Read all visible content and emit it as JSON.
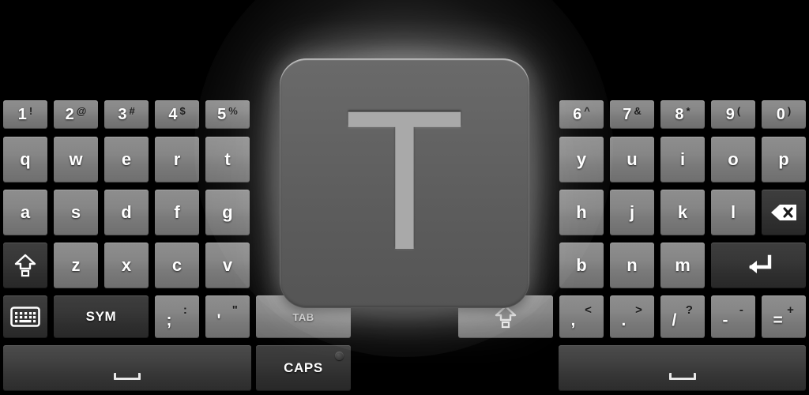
{
  "keyboard": {
    "title": "Android Hardware-Style Soft Keyboard",
    "theme": {
      "background": "#000000",
      "key_light": "#868686",
      "key_dark": "#373737",
      "key_space": "#434343",
      "text": "#ffffff",
      "alt_text": "#1c1c1c",
      "preview_face": "#636363",
      "preview_glyph": "#a9a9a9",
      "glow": "#ffffff"
    },
    "preview": {
      "character": "T",
      "source_key": "t"
    },
    "rows": [
      {
        "name": "number-row",
        "keys": [
          {
            "name": "key-1",
            "main": "1",
            "alt": "!",
            "type": "number"
          },
          {
            "name": "key-2",
            "main": "2",
            "alt": "@",
            "type": "number"
          },
          {
            "name": "key-3",
            "main": "3",
            "alt": "#",
            "type": "number"
          },
          {
            "name": "key-4",
            "main": "4",
            "alt": "$",
            "type": "number"
          },
          {
            "name": "key-5",
            "main": "5",
            "alt": "%",
            "type": "number"
          },
          {
            "name": "key-6",
            "main": "6",
            "alt": "^",
            "type": "number"
          },
          {
            "name": "key-7",
            "main": "7",
            "alt": "&",
            "type": "number"
          },
          {
            "name": "key-8",
            "main": "8",
            "alt": "*",
            "type": "number"
          },
          {
            "name": "key-9",
            "main": "9",
            "alt": "(",
            "type": "number"
          },
          {
            "name": "key-0",
            "main": "0",
            "alt": ")",
            "type": "number"
          }
        ]
      },
      {
        "name": "letter-row-1",
        "keys": [
          {
            "name": "key-q",
            "main": "q",
            "type": "letter"
          },
          {
            "name": "key-w",
            "main": "w",
            "type": "letter"
          },
          {
            "name": "key-e",
            "main": "e",
            "type": "letter"
          },
          {
            "name": "key-r",
            "main": "r",
            "type": "letter"
          },
          {
            "name": "key-t",
            "main": "t",
            "type": "letter"
          },
          {
            "name": "key-y",
            "main": "y",
            "type": "letter"
          },
          {
            "name": "key-u",
            "main": "u",
            "type": "letter"
          },
          {
            "name": "key-i",
            "main": "i",
            "type": "letter"
          },
          {
            "name": "key-o",
            "main": "o",
            "type": "letter"
          },
          {
            "name": "key-p",
            "main": "p",
            "type": "letter"
          }
        ]
      },
      {
        "name": "letter-row-2",
        "keys": [
          {
            "name": "key-a",
            "main": "a",
            "type": "letter"
          },
          {
            "name": "key-s",
            "main": "s",
            "type": "letter"
          },
          {
            "name": "key-d",
            "main": "d",
            "type": "letter"
          },
          {
            "name": "key-f",
            "main": "f",
            "type": "letter"
          },
          {
            "name": "key-g",
            "main": "g",
            "type": "letter"
          },
          {
            "name": "key-h",
            "main": "h",
            "type": "letter"
          },
          {
            "name": "key-j",
            "main": "j",
            "type": "letter"
          },
          {
            "name": "key-k",
            "main": "k",
            "type": "letter"
          },
          {
            "name": "key-l",
            "main": "l",
            "type": "letter"
          },
          {
            "name": "key-backspace",
            "main": "",
            "icon": "backspace-icon",
            "type": "function"
          }
        ]
      },
      {
        "name": "letter-row-3",
        "keys": [
          {
            "name": "key-shift-left",
            "main": "",
            "icon": "shift-icon",
            "type": "function"
          },
          {
            "name": "key-z",
            "main": "z",
            "type": "letter"
          },
          {
            "name": "key-x",
            "main": "x",
            "type": "letter"
          },
          {
            "name": "key-c",
            "main": "c",
            "type": "letter"
          },
          {
            "name": "key-v",
            "main": "v",
            "type": "letter"
          },
          {
            "name": "key-b",
            "main": "b",
            "type": "letter"
          },
          {
            "name": "key-n",
            "main": "n",
            "type": "letter"
          },
          {
            "name": "key-m",
            "main": "m",
            "type": "letter"
          },
          {
            "name": "key-enter",
            "main": "",
            "icon": "enter-icon",
            "type": "function"
          }
        ]
      },
      {
        "name": "symbol-row",
        "keys": [
          {
            "name": "key-keyboard-toggle",
            "main": "",
            "icon": "keyboard-icon",
            "type": "function"
          },
          {
            "name": "key-sym",
            "main": "SYM",
            "type": "function"
          },
          {
            "name": "key-semicolon",
            "main": ";",
            "alt": ":",
            "type": "punct"
          },
          {
            "name": "key-apostrophe",
            "main": "'",
            "alt": "\"",
            "type": "punct"
          },
          {
            "name": "key-tab",
            "main": "TAB",
            "type": "function"
          },
          {
            "name": "key-shift-right",
            "main": "",
            "icon": "shift-icon",
            "type": "function"
          },
          {
            "name": "key-comma",
            "main": ",",
            "alt": "<",
            "type": "punct"
          },
          {
            "name": "key-period",
            "main": ".",
            "alt": ">",
            "type": "punct"
          },
          {
            "name": "key-slash",
            "main": "/",
            "alt": "?",
            "type": "punct"
          },
          {
            "name": "key-minus",
            "main": "-",
            "alt": "-",
            "type": "punct"
          },
          {
            "name": "key-equals",
            "main": "=",
            "alt": "+",
            "type": "punct"
          }
        ]
      },
      {
        "name": "space-row",
        "keys": [
          {
            "name": "key-space-left",
            "main": "",
            "icon": "space-icon",
            "type": "space"
          },
          {
            "name": "key-caps",
            "main": "CAPS",
            "type": "function",
            "indicator": "caps-lock-led"
          },
          {
            "name": "key-space-right",
            "main": "",
            "icon": "space-icon",
            "type": "space"
          }
        ]
      }
    ]
  }
}
